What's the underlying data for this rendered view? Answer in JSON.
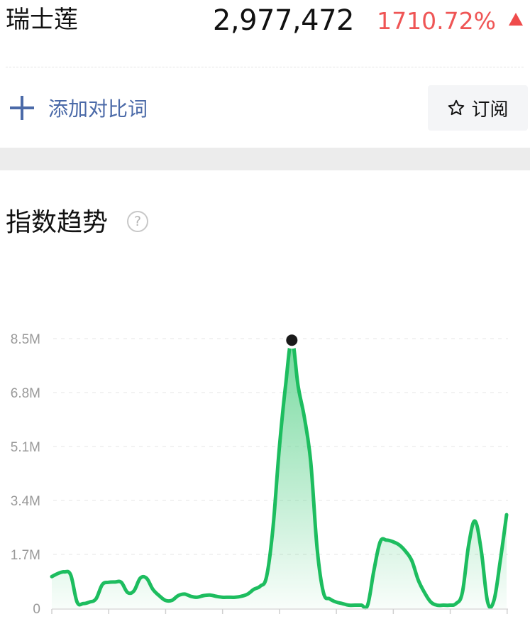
{
  "header": {
    "keyword": "瑞士莲",
    "index_value": "2,977,472",
    "change": "1710.72%",
    "change_color": "#ef5555"
  },
  "actions": {
    "add_compare_label": "添加对比词",
    "subscribe_label": "订阅",
    "add_icon": "plus-icon",
    "subscribe_icon": "star-icon"
  },
  "section": {
    "title": "指数趋势",
    "help_icon": "?"
  },
  "colors": {
    "line": "#1dbd5f",
    "fill_top": "#5fd38e",
    "highlight_point": "#1a1a1a"
  },
  "chart_data": {
    "type": "area",
    "y_unit": "M",
    "yticks": [
      "0",
      "1.7M",
      "3.4M",
      "5.1M",
      "6.8M",
      "8.5M"
    ],
    "ylim": [
      0,
      8.5
    ],
    "grid": true,
    "highlighted_point_index": 38,
    "values": [
      1.0,
      1.1,
      1.15,
      1.05,
      0.2,
      0.15,
      0.2,
      0.3,
      0.75,
      0.82,
      0.83,
      0.82,
      0.5,
      0.55,
      0.95,
      0.95,
      0.6,
      0.4,
      0.25,
      0.25,
      0.4,
      0.45,
      0.38,
      0.35,
      0.4,
      0.42,
      0.38,
      0.35,
      0.35,
      0.35,
      0.38,
      0.45,
      0.6,
      0.7,
      1.0,
      2.5,
      5.0,
      7.0,
      8.45,
      7.0,
      6.0,
      4.6,
      1.9,
      0.5,
      0.3,
      0.2,
      0.15,
      0.1,
      0.1,
      0.1,
      0.1,
      1.2,
      2.1,
      2.15,
      2.1,
      2.0,
      1.8,
      1.5,
      0.9,
      0.5,
      0.2,
      0.1,
      0.1,
      0.1,
      0.15,
      0.5,
      2.0,
      2.75,
      1.8,
      0.2,
      0.25,
      1.5,
      2.95
    ]
  }
}
